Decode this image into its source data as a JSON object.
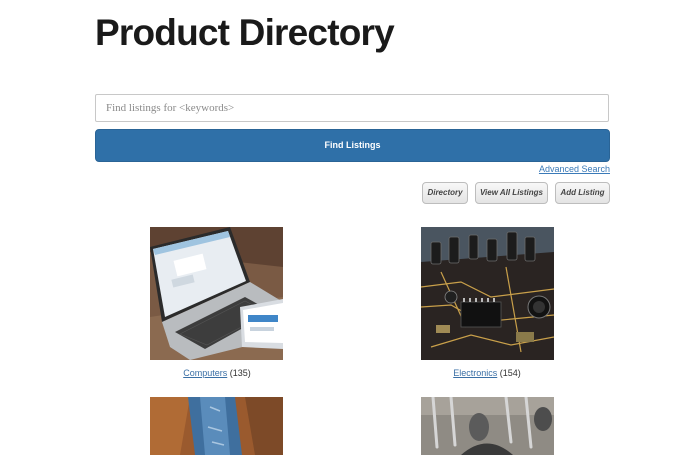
{
  "page": {
    "title": "Product Directory"
  },
  "search": {
    "placeholder": "Find listings for <keywords>",
    "value": "",
    "submit_label": "Find Listings",
    "advanced_label": "Advanced Search"
  },
  "actions": [
    {
      "label": "Directory"
    },
    {
      "label": "View All Listings"
    },
    {
      "label": "Add Listing"
    }
  ],
  "categories": [
    {
      "name": "Computers",
      "count": "(135)",
      "image": "laptop-and-tablet-photo"
    },
    {
      "name": "Electronics",
      "count": "(154)",
      "image": "circuit-board-photo"
    },
    {
      "name": "",
      "count": "",
      "image": "denim-jeans-photo"
    },
    {
      "name": "",
      "count": "",
      "image": "kitchen-utensils-photo"
    }
  ],
  "colors": {
    "primary_button": "#2f70a8",
    "link": "#3a6fa5",
    "title_text": "#1a1a1a"
  }
}
